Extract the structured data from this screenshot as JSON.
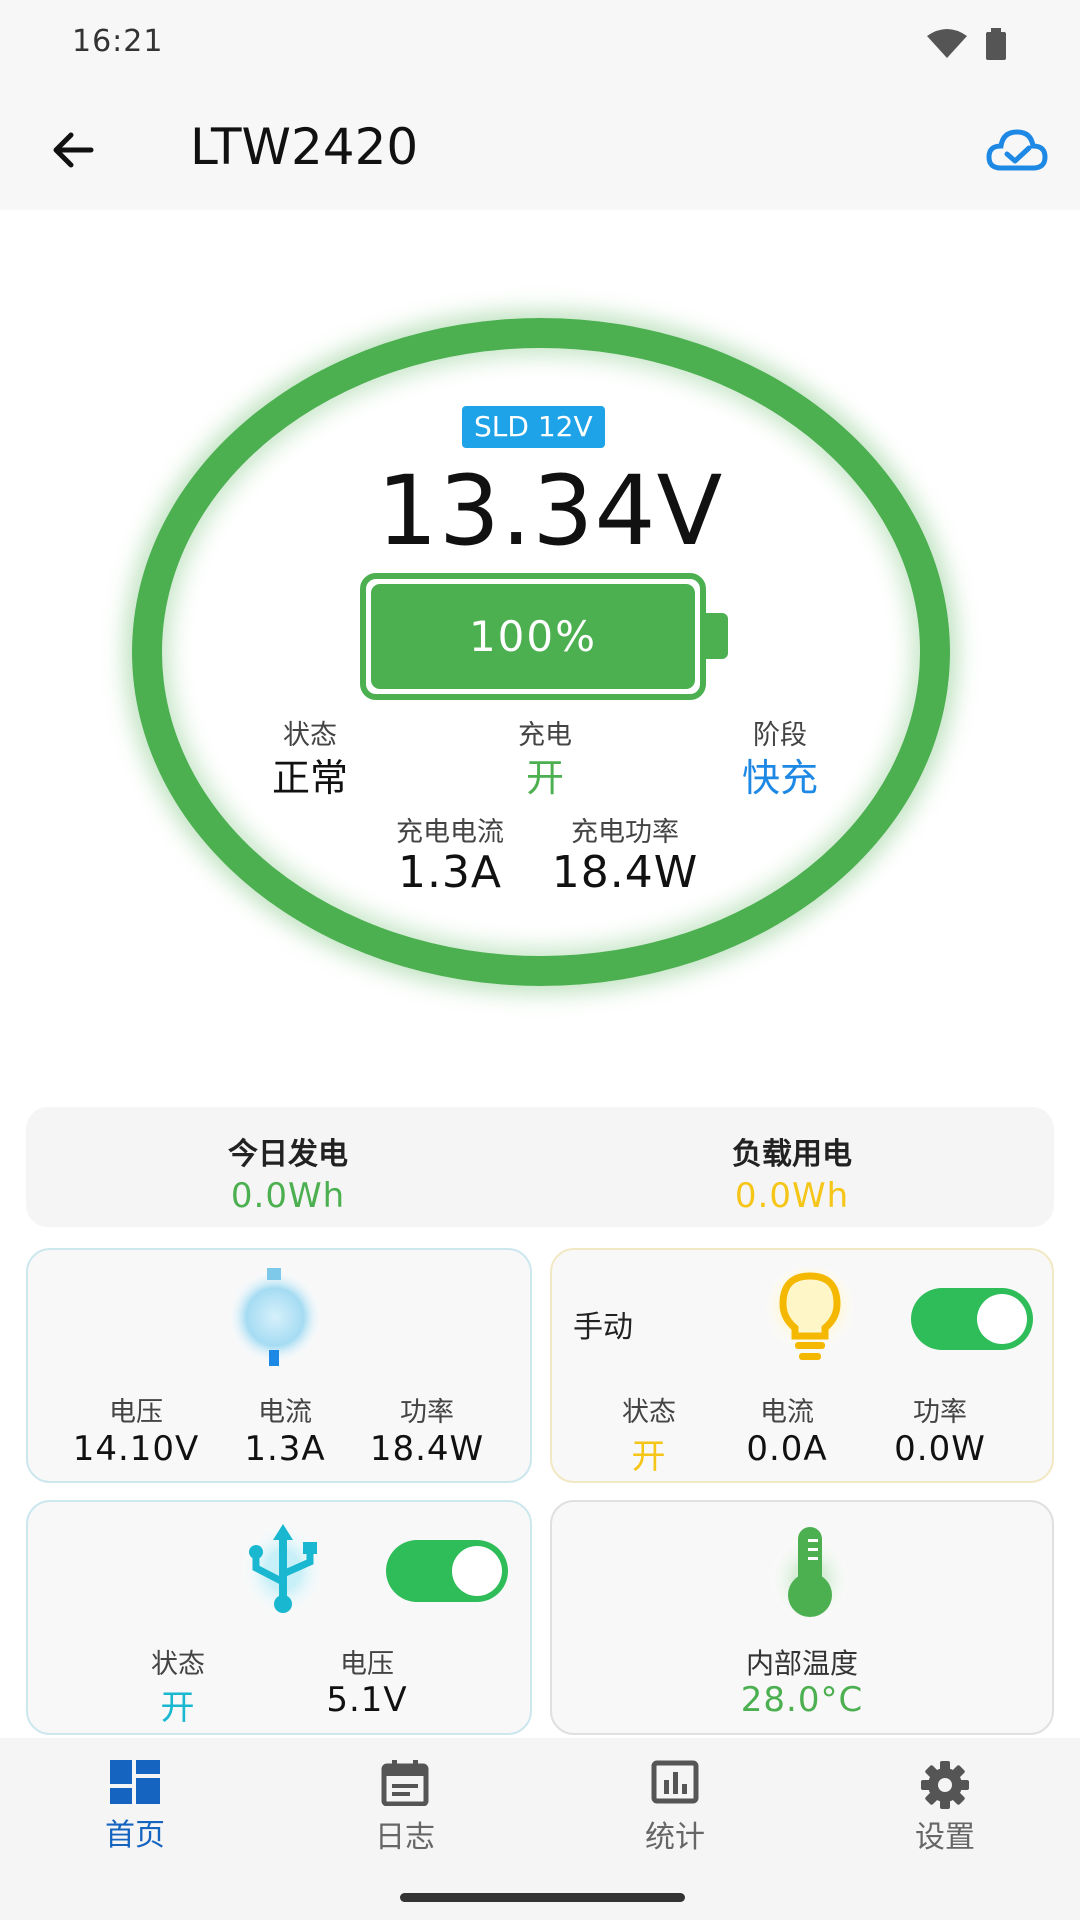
{
  "status_bar": {
    "time": "16:21",
    "wifi_icon": "wifi-icon",
    "battery_icon": "battery-icon"
  },
  "app_bar": {
    "title": "LTW2420",
    "back_icon": "arrow-left-icon",
    "cloud_icon": "cloud-check-icon"
  },
  "gauge": {
    "model": "SLD 12V",
    "voltage": "13.34V",
    "battery_percent_text": "100%",
    "battery_level": 1.0,
    "status": {
      "label": "状态",
      "value": "正常"
    },
    "charging": {
      "label": "充电",
      "value": "开"
    },
    "stage": {
      "label": "阶段",
      "value": "快充"
    },
    "charge_current": {
      "label": "充电电流",
      "value": "1.3A"
    },
    "charge_power": {
      "label": "充电功率",
      "value": "18.4W"
    }
  },
  "summary": {
    "generation": {
      "label": "今日发电",
      "value": "0.0Wh"
    },
    "load_usage": {
      "label": "负载用电",
      "value": "0.0Wh"
    }
  },
  "solar_card": {
    "icon": "solar-panel-icon",
    "voltage": {
      "label": "电压",
      "value": "14.10V"
    },
    "current": {
      "label": "电流",
      "value": "1.3A"
    },
    "power": {
      "label": "功率",
      "value": "18.4W"
    }
  },
  "load_card": {
    "mode": "手动",
    "icon": "lightbulb-icon",
    "toggle_on": true,
    "status": {
      "label": "状态",
      "value": "开"
    },
    "current": {
      "label": "电流",
      "value": "0.0A"
    },
    "power": {
      "label": "功率",
      "value": "0.0W"
    }
  },
  "usb_card": {
    "icon": "usb-icon",
    "toggle_on": true,
    "status": {
      "label": "状态",
      "value": "开"
    },
    "voltage": {
      "label": "电压",
      "value": "5.1V"
    }
  },
  "temp_card": {
    "icon": "thermometer-icon",
    "label": "内部温度",
    "value": "28.0°C"
  },
  "bottom_nav": {
    "items": [
      {
        "label": "首页",
        "icon": "dashboard-icon",
        "active": true
      },
      {
        "label": "日志",
        "icon": "calendar-icon",
        "active": false
      },
      {
        "label": "统计",
        "icon": "bar-chart-icon",
        "active": false
      },
      {
        "label": "设置",
        "icon": "gear-icon",
        "active": false
      }
    ]
  },
  "colors": {
    "green": "#4caf50",
    "blue": "#1ea3e8",
    "yellow": "#f5c518",
    "cyan": "#19b8d0",
    "toggle_green": "#2ebd59"
  }
}
